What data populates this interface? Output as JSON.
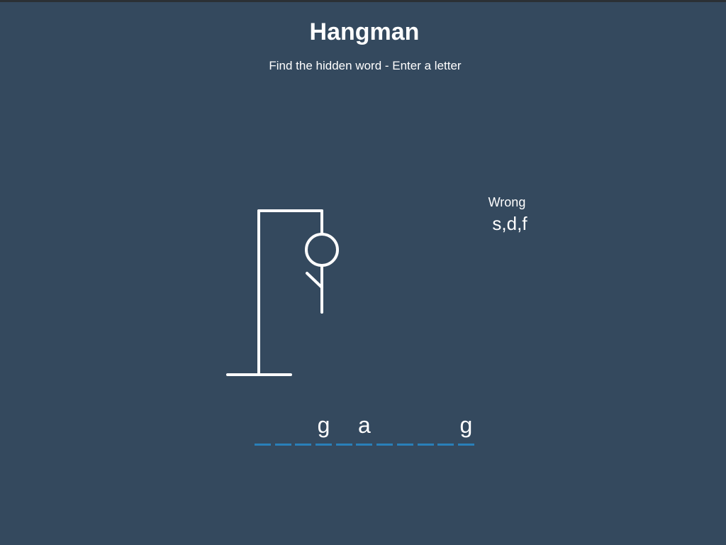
{
  "title": "Hangman",
  "subtitle": "Find the hidden word - Enter a letter",
  "wrong": {
    "label": "Wrong",
    "letters": "s,d,f"
  },
  "word": {
    "slots": [
      "",
      "",
      "",
      "g",
      "",
      "a",
      "",
      "",
      "",
      "",
      "g"
    ]
  },
  "colors": {
    "background": "#34495e",
    "text": "#ffffff",
    "underline": "#2980b9"
  }
}
